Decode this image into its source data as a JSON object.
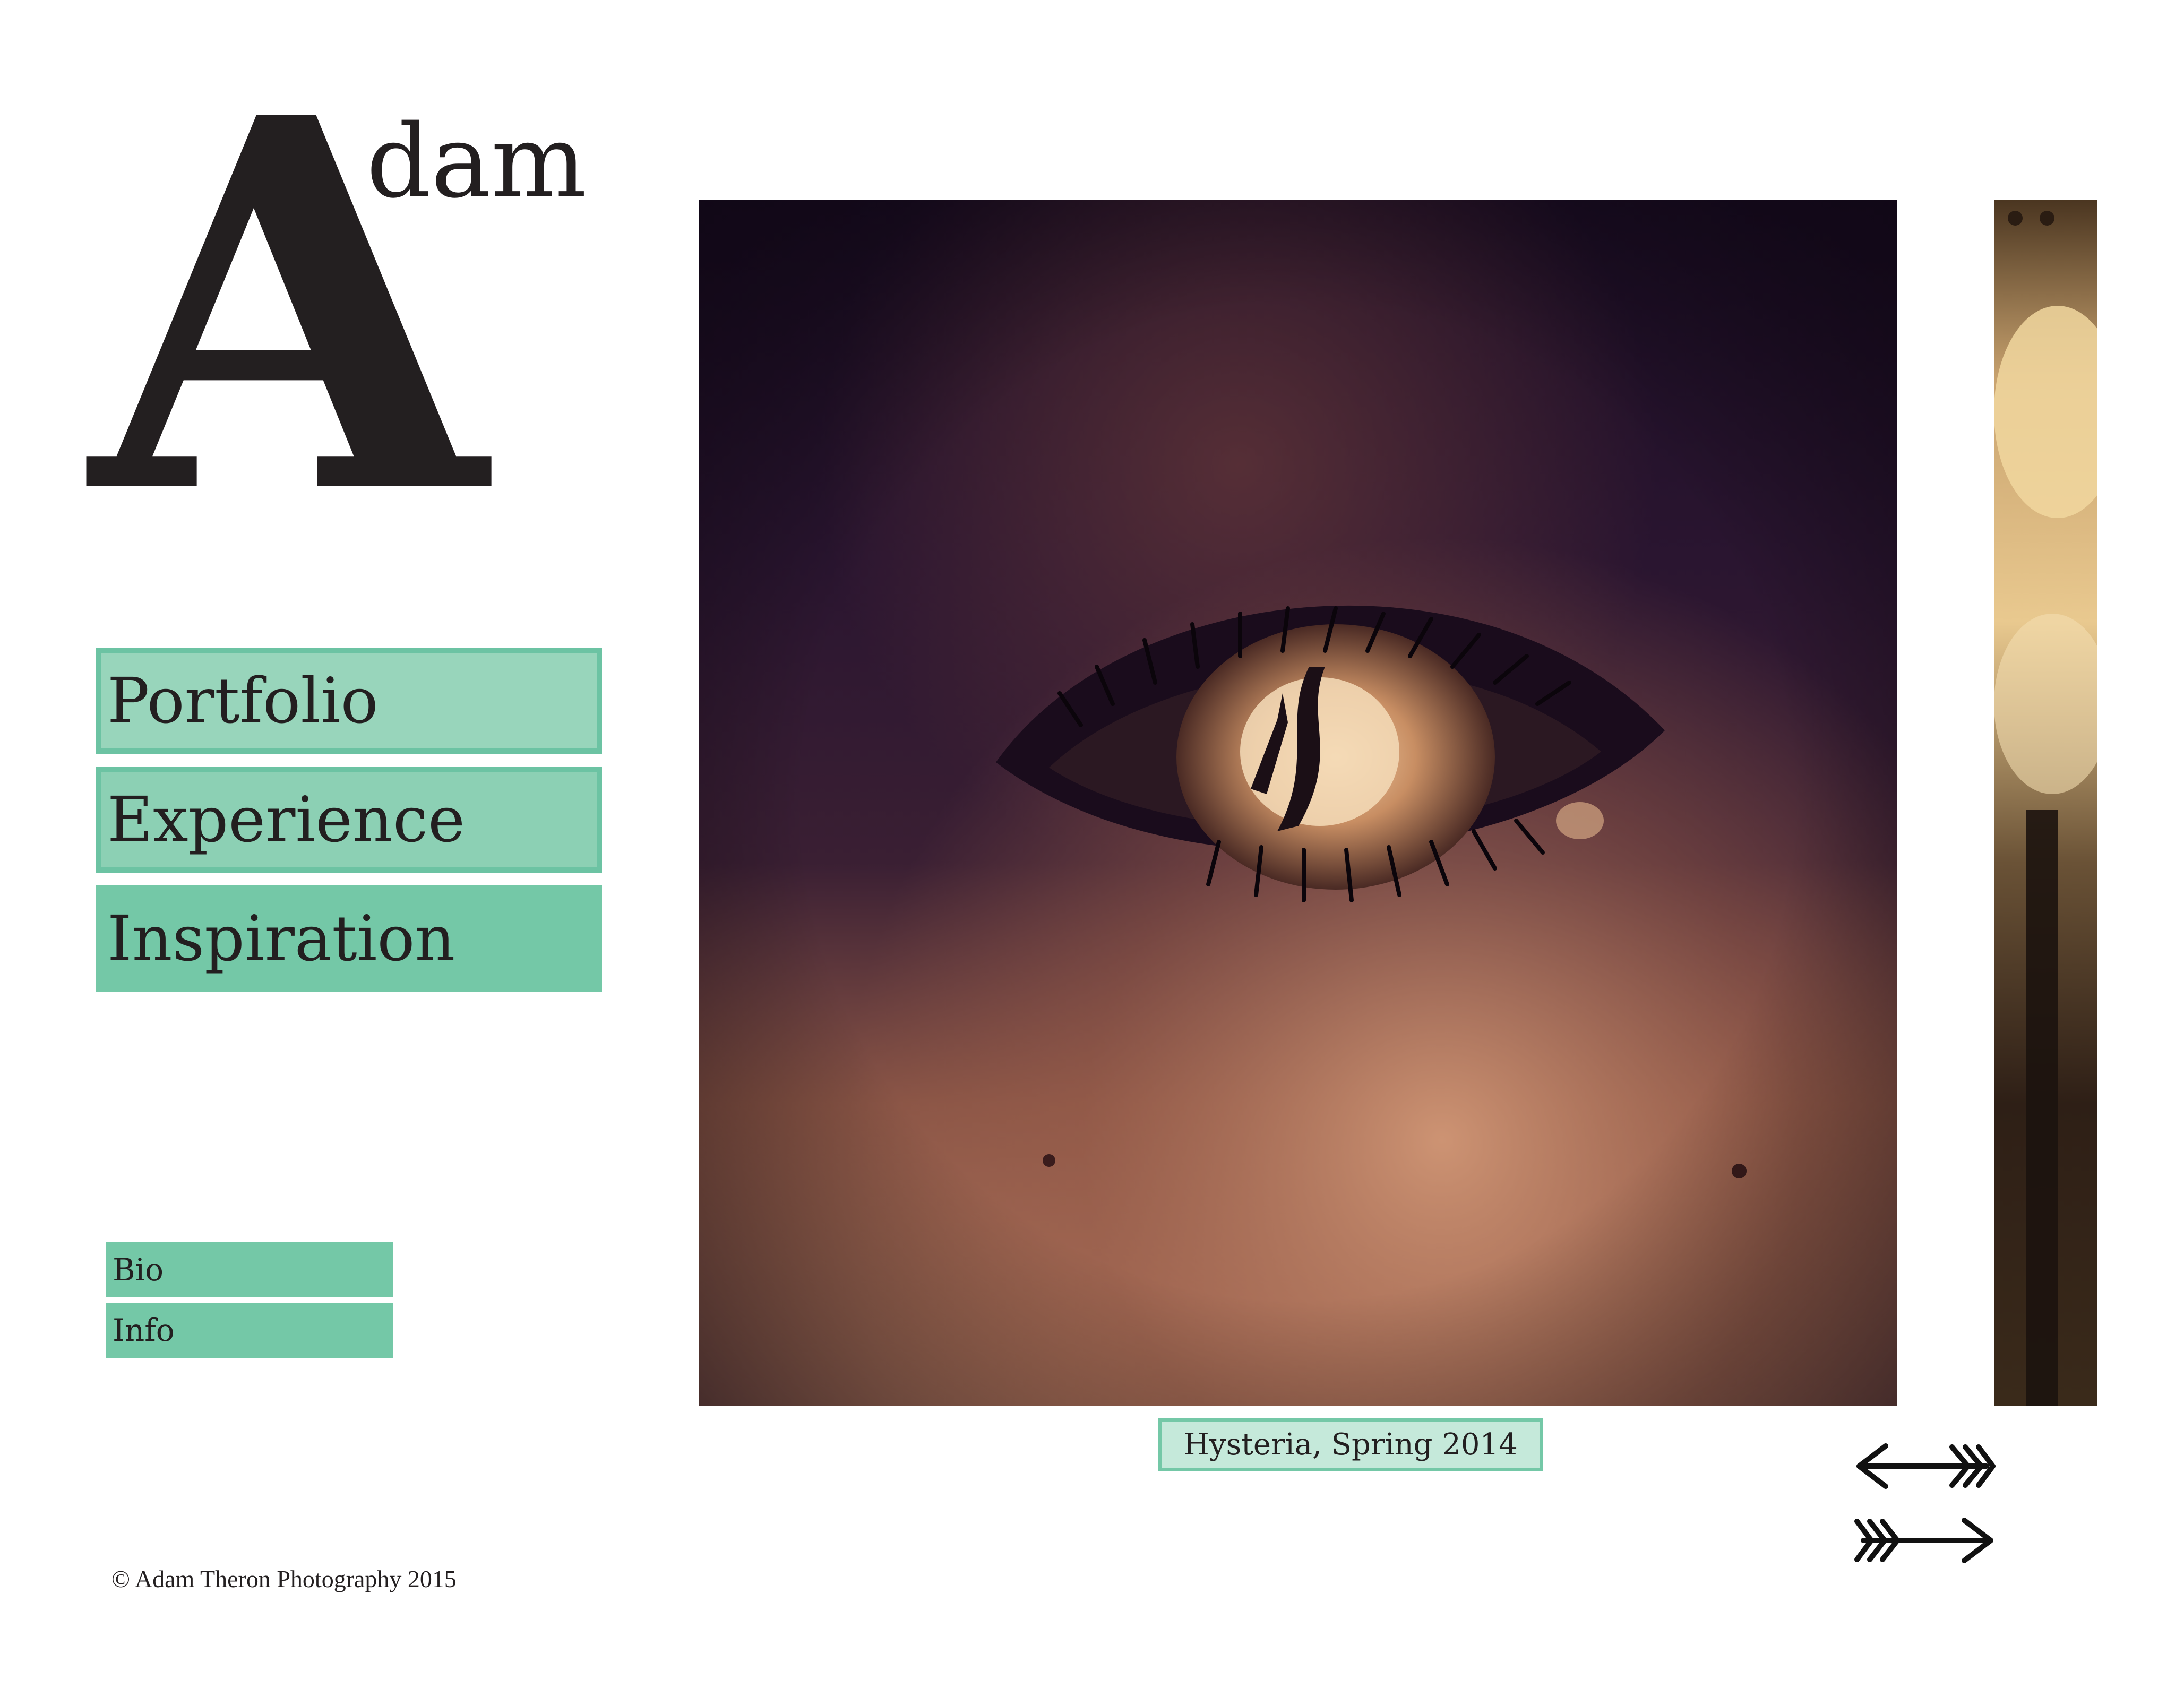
{
  "logo": {
    "initial": "A",
    "rest": "dam"
  },
  "nav": {
    "items": [
      {
        "label": "Portfolio"
      },
      {
        "label": "Experience"
      },
      {
        "label": "Inspiration"
      }
    ]
  },
  "subnav": {
    "items": [
      {
        "label": "Bio"
      },
      {
        "label": "Info"
      }
    ]
  },
  "gallery": {
    "caption": "Hysteria, Spring 2014",
    "prev_icon": "arrow-left-icon",
    "next_icon": "arrow-right-icon"
  },
  "footer": {
    "copyright": "© Adam Theron Photography 2015"
  },
  "colors": {
    "accent": "#74c8a7",
    "accent_light": "#98d5bb",
    "caption_bg": "#c5e9da",
    "text": "#231f20"
  }
}
